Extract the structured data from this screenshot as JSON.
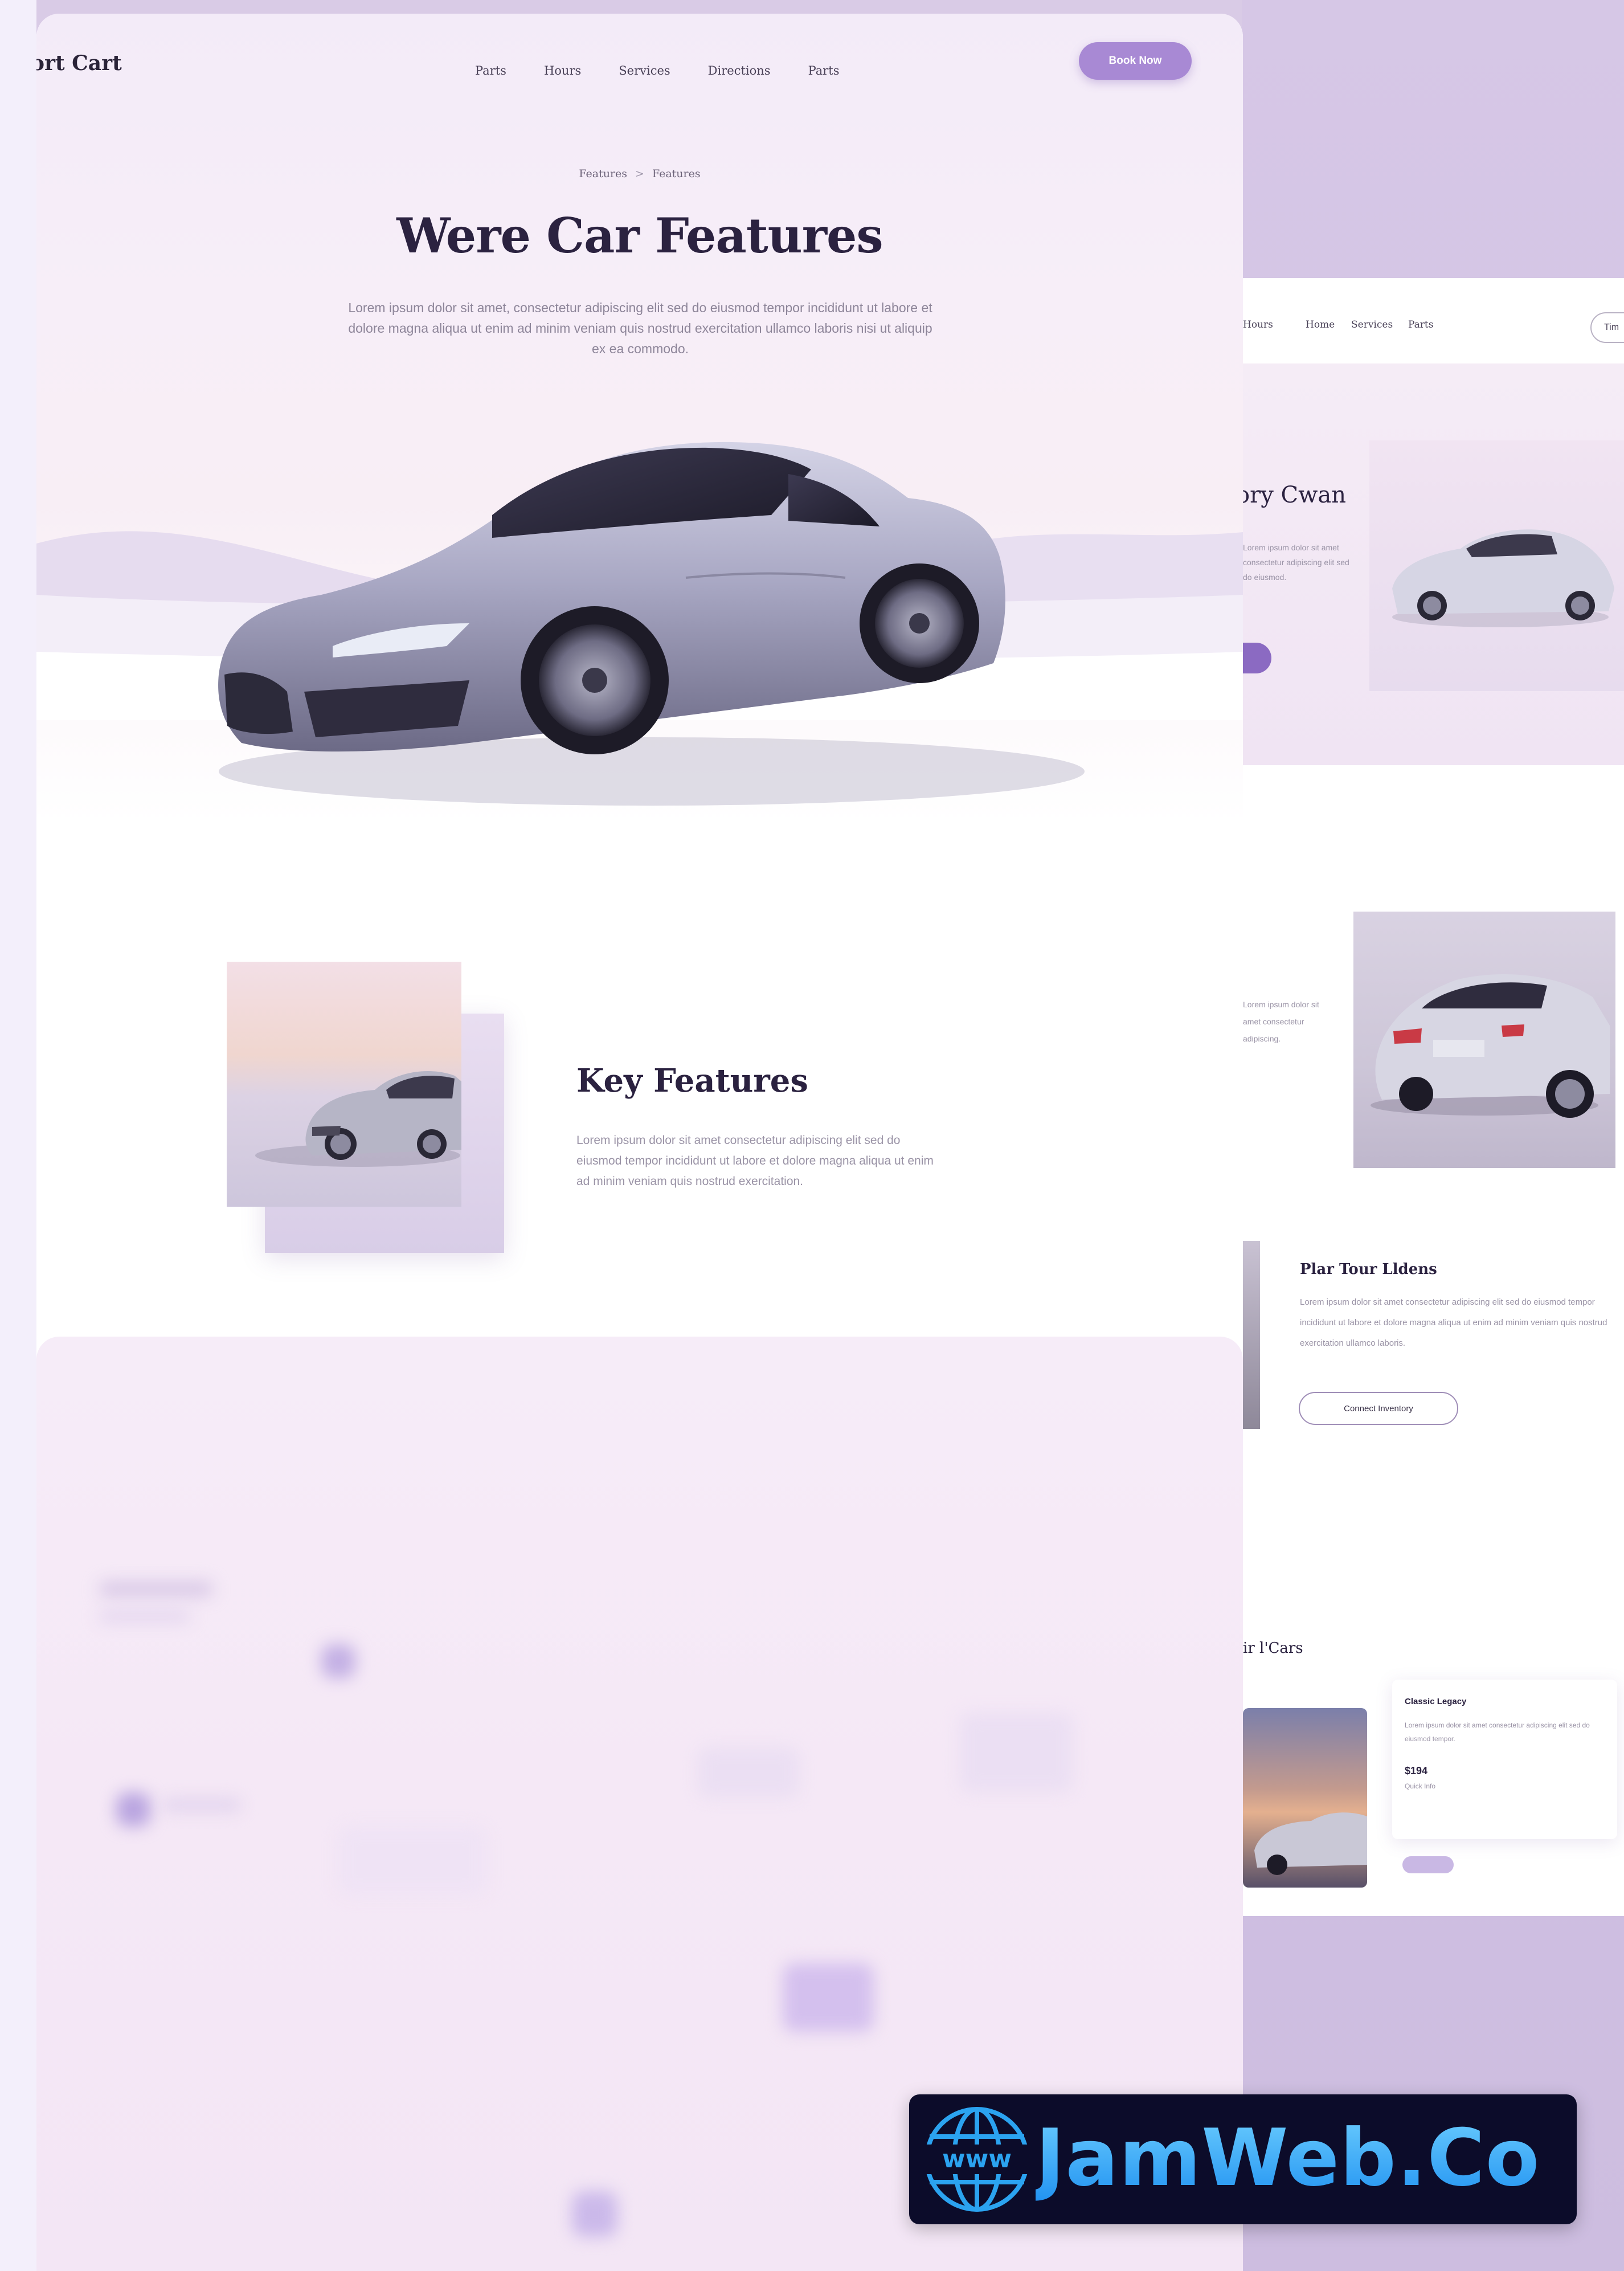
{
  "main": {
    "logo": "ort Cart",
    "nav_links": [
      "Parts",
      "Hours",
      "Services",
      "Directions",
      "Parts"
    ],
    "nav_cta": "Book Now",
    "breadcrumb": [
      "Features",
      "Features"
    ],
    "hero_title": "Were Car Features",
    "hero_copy": "Lorem ipsum dolor sit amet, consectetur adipiscing elit sed do eiusmod tempor incididunt ut labore et dolore magna aliqua ut enim ad minim veniam quis nostrud exercitation ullamco laboris nisi ut aliquip ex ea commodo.",
    "features_title": "Key Features",
    "features_copy": "Lorem ipsum dolor sit amet consectetur adipiscing elit sed do eiusmod tempor incididunt ut labore et dolore magna aliqua ut enim ad minim veniam quis nostrud exercitation."
  },
  "right": {
    "nav_links": [
      "Hours",
      "Home",
      "Services",
      "Parts"
    ],
    "nav_button": "Tim",
    "section1_title": "ory Cwan",
    "section1_copy": "Lorem ipsum dolor sit amet consectetur adipiscing elit sed do eiusmod.",
    "section2_copy": "Lorem ipsum dolor sit amet consectetur adipiscing.",
    "section3_title": "Plar Tour Lldens",
    "section3_copy": "Lorem ipsum dolor sit amet consectetur adipiscing elit sed do eiusmod tempor incididunt ut labore et dolore magna aliqua ut enim ad minim veniam quis nostrud exercitation ullamco laboris.",
    "section3_button": "Connect Inventory",
    "section4_title": "ir l'Cars",
    "card_title": "Classic Legacy",
    "card_desc": "Lorem ipsum dolor sit amet consectetur adipiscing elit sed do eiusmod tempor.",
    "card_price": "$194",
    "card_sub": "Quick Info"
  },
  "badge": {
    "text": "JamWeb.Co",
    "globe_label": "www"
  },
  "colors": {
    "accent": "#a889d4",
    "title": "#2b2240",
    "badge_bg": "#0c0c2a",
    "badge_text": "#27a7f3"
  }
}
